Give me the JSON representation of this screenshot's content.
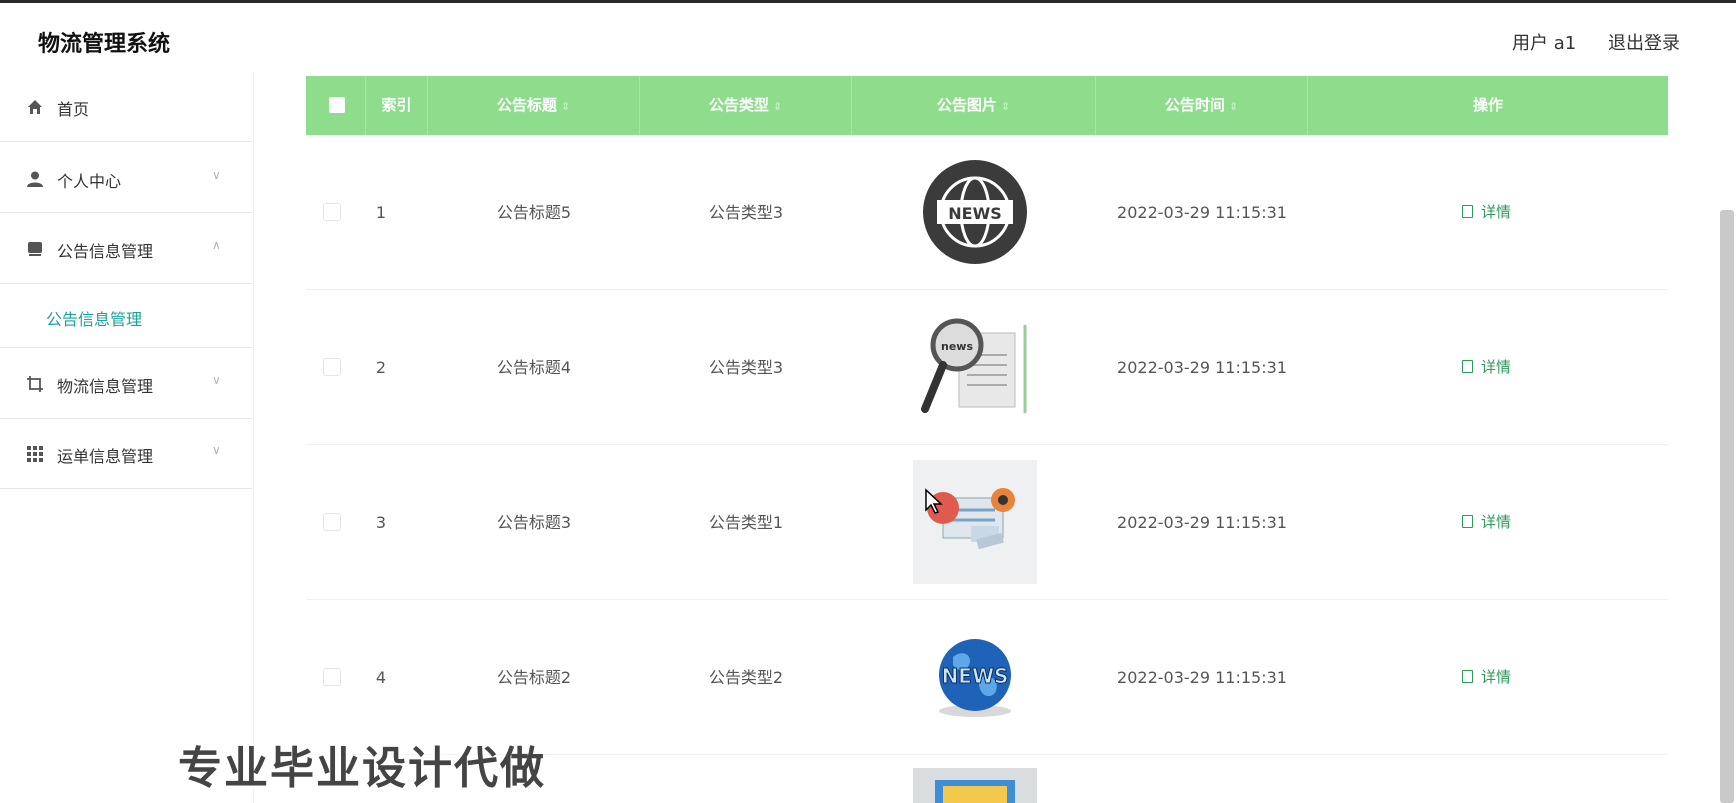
{
  "header": {
    "brand": "物流管理系统",
    "user_label": "用户 a1",
    "logout_label": "退出登录"
  },
  "sidebar": {
    "items": [
      {
        "label": "首页",
        "icon": "home-icon"
      },
      {
        "label": "个人中心",
        "icon": "user-icon"
      },
      {
        "label": "公告信息管理",
        "icon": "notice-icon"
      },
      {
        "label": "物流信息管理",
        "icon": "box-icon"
      },
      {
        "label": "运单信息管理",
        "icon": "grid-icon"
      }
    ],
    "submenu_active": "公告信息管理"
  },
  "table": {
    "headers": {
      "index": "索引",
      "title": "公告标题",
      "type": "公告类型",
      "image": "公告图片",
      "time": "公告时间",
      "action": "操作"
    },
    "rows": [
      {
        "index": "1",
        "title": "公告标题5",
        "type": "公告类型3",
        "time": "2022-03-29 11:15:31",
        "action": "详情",
        "image": "news-globe-dark-icon"
      },
      {
        "index": "2",
        "title": "公告标题4",
        "type": "公告类型3",
        "time": "2022-03-29 11:15:31",
        "action": "详情",
        "image": "news-magnifier-icon"
      },
      {
        "index": "3",
        "title": "公告标题3",
        "type": "公告类型1",
        "time": "2022-03-29 11:15:31",
        "action": "详情",
        "image": "news-pin-icon"
      },
      {
        "index": "4",
        "title": "公告标题2",
        "type": "公告类型2",
        "time": "2022-03-29 11:15:31",
        "action": "详情",
        "image": "news-globe-blue-icon"
      }
    ]
  },
  "watermark": "专业毕业设计代做",
  "colors": {
    "header_green": "#8ddd8d",
    "active_teal": "#1aa39a",
    "action_green": "#2e9a5a"
  }
}
